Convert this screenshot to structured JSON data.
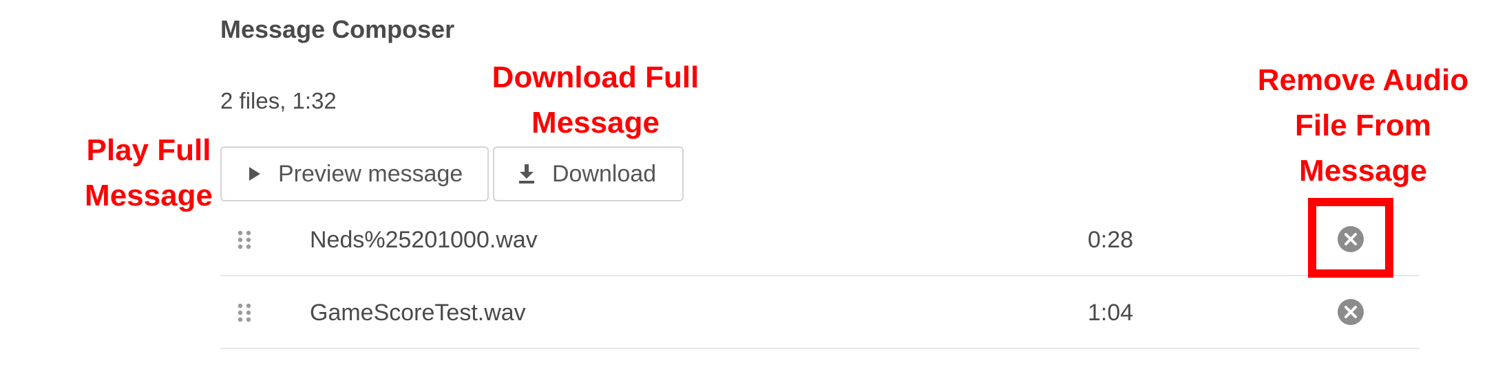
{
  "composer": {
    "title": "Message Composer",
    "summary": "2 files, 1:32",
    "preview_label": "Preview message",
    "preview_icon": "play-icon",
    "download_label": "Download",
    "download_icon": "download-icon"
  },
  "files": [
    {
      "name": "Neds%25201000.wav",
      "duration": "0:28",
      "drag_icon": "drag-handle-icon",
      "remove_icon": "remove-circle-icon"
    },
    {
      "name": "GameScoreTest.wav",
      "duration": "1:04",
      "drag_icon": "drag-handle-icon",
      "remove_icon": "remove-circle-icon"
    }
  ],
  "annotations": {
    "play": [
      "Play Full",
      "Message"
    ],
    "download": [
      "Download Full",
      "Message"
    ],
    "remove": [
      "Remove Audio",
      "File From",
      "Message"
    ],
    "color": "#ff0000"
  },
  "colors": {
    "text": "#4a4a4a",
    "border": "#d4d4d4",
    "remove_icon": "#8c8c8c",
    "divider": "#e6e6e6"
  }
}
